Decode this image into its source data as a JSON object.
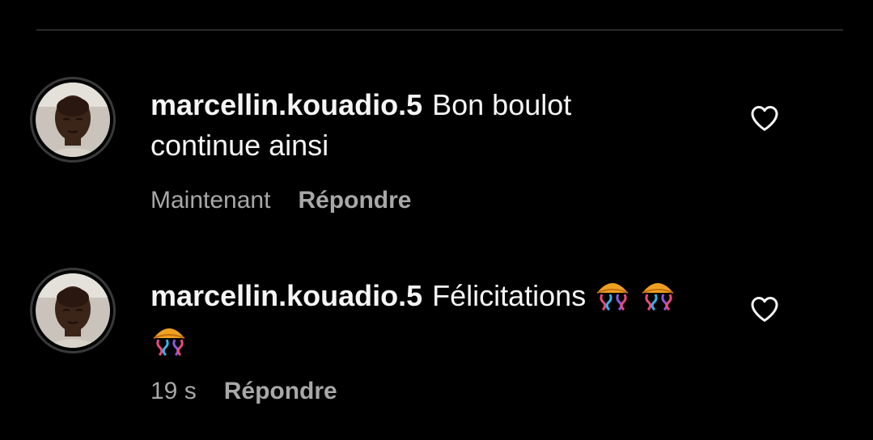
{
  "comments": [
    {
      "username": "marcellin.kouadio.5",
      "line1": "Bon boulot",
      "line2": "continue ainsi",
      "time": "Maintenant",
      "reply_label": "Répondre",
      "avatar_icon": "profile-photo",
      "like_icon": "heart-outline-icon"
    },
    {
      "username": "marcellin.kouadio.5",
      "text": "Félicitations",
      "emoji": "confetti-ball-emoji",
      "emoji_count": 3,
      "time": "19 s",
      "reply_label": "Répondre",
      "avatar_icon": "profile-photo",
      "like_icon": "heart-outline-icon"
    }
  ],
  "colors": {
    "background": "#000000",
    "text_primary": "#f5f5f5",
    "text_secondary": "#a8a8a8",
    "divider": "#2b2b2b"
  }
}
